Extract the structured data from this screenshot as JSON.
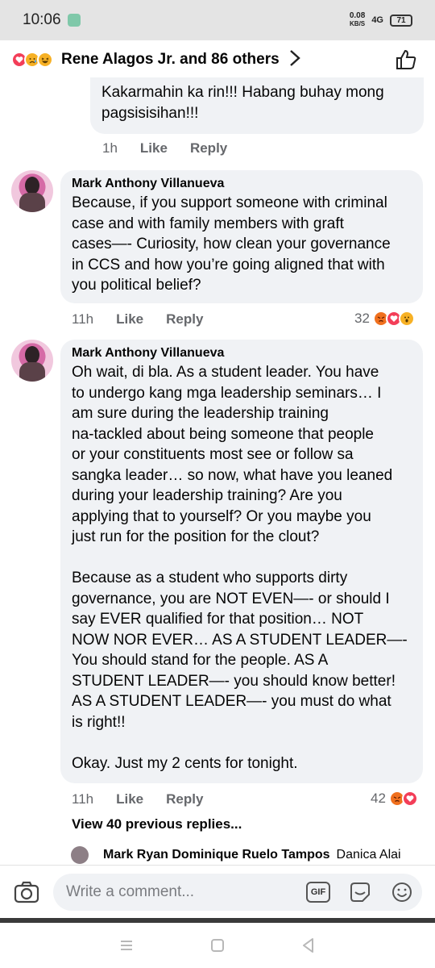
{
  "status": {
    "time": "10:06",
    "net_speed_value": "0.08",
    "net_speed_unit": "KB/S",
    "signal": "4G",
    "battery": "71"
  },
  "header": {
    "title": "Rene Alagos Jr. and 86 others",
    "reactions": [
      "love",
      "sad",
      "haha"
    ]
  },
  "comments": [
    {
      "author": "",
      "text": "Kakarmahin ka rin!!! Habang buhay mong\npagsisisihan!!!",
      "time": "1h",
      "like": "Like",
      "reply": "Reply"
    },
    {
      "author": "Mark Anthony Villanueva",
      "text": "Because, if you support someone with criminal\ncase and with family members with graft\ncases—- Curiosity, how clean your governance\nin CCS and how you’re going aligned that with\nyou political belief?",
      "time": "11h",
      "like": "Like",
      "reply": "Reply",
      "reaction_count": "32",
      "reactions": [
        "angry",
        "love",
        "wow"
      ]
    },
    {
      "author": "Mark Anthony Villanueva",
      "text": "Oh wait, di bla. As a student leader. You have\nto undergo kang mga leadership seminars… I\nam sure during the leadership training\nna-tackled about being someone that people\nor your constituents most see or follow sa\nsangka leader… so now, what have you leaned\nduring your leadership training? Are you\napplying that to yourself? Or you maybe you\njust run for the position for the clout?\n\nBecause as a student who supports dirty\ngovernance, you are NOT EVEN—- or should I\nsay EVER qualified for that position… NOT\nNOW NOR EVER… AS A STUDENT LEADER—-\nYou should stand for the people. AS A\nSTUDENT LEADER—- you should know better!\nAS A STUDENT LEADER—- you must do what\nis right!!\n\nOkay. Just my 2 cents for tonight.",
      "time": "11h",
      "like": "Like",
      "reply": "Reply",
      "reaction_count": "42",
      "reactions": [
        "angry",
        "love"
      ]
    }
  ],
  "view_more": "View 40 previous replies...",
  "reply_preview": {
    "names": "Mark Ryan Dominique Ruelo Tampos",
    "extra": "Danica Alai"
  },
  "composer": {
    "placeholder": "Write a comment...",
    "gif_label": "GIF"
  },
  "colors": {
    "bubble": "#f0f2f5",
    "meta_text": "#65676b",
    "angry": "#f0701e",
    "love": "#f33e58",
    "wow": "#f7b125"
  }
}
